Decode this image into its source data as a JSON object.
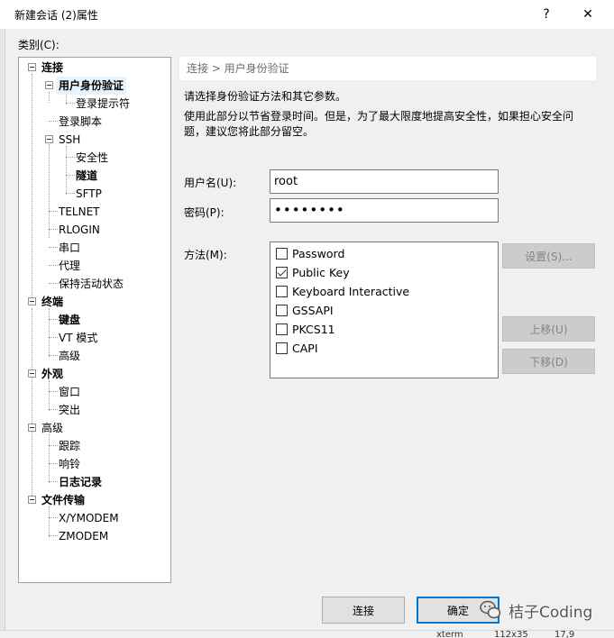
{
  "window": {
    "title": "新建会话 (2)属性",
    "help_glyph": "?",
    "close_glyph": "✕"
  },
  "category": {
    "label": "类别(C):"
  },
  "tree": {
    "items": [
      {
        "label": "连接"
      },
      {
        "label": "用户身份验证"
      },
      {
        "label": "登录提示符"
      },
      {
        "label": "登录脚本"
      },
      {
        "label": "SSH"
      },
      {
        "label": "安全性"
      },
      {
        "label": "隧道"
      },
      {
        "label": "SFTP"
      },
      {
        "label": "TELNET"
      },
      {
        "label": "RLOGIN"
      },
      {
        "label": "串口"
      },
      {
        "label": "代理"
      },
      {
        "label": "保持活动状态"
      },
      {
        "label": "终端"
      },
      {
        "label": "键盘"
      },
      {
        "label": "VT 模式"
      },
      {
        "label": "高级"
      },
      {
        "label": "外观"
      },
      {
        "label": "窗口"
      },
      {
        "label": "突出"
      },
      {
        "label": "高级"
      },
      {
        "label": "跟踪"
      },
      {
        "label": "响铃"
      },
      {
        "label": "日志记录"
      },
      {
        "label": "文件传输"
      },
      {
        "label": "X/YMODEM"
      },
      {
        "label": "ZMODEM"
      }
    ]
  },
  "panel": {
    "breadcrumb": "连接 > 用户身份验证",
    "description_1": "请选择身份验证方法和其它参数。",
    "description_2": "使用此部分以节省登录时间。但是，为了最大限度地提高安全性，如果担心安全问题，建议您将此部分留空。",
    "username_label": "用户名(U):",
    "username_value": "root",
    "password_label": "密码(P):",
    "password_value": "••••••••",
    "method_label": "方法(M):",
    "methods": [
      {
        "label": "Password",
        "checked": false
      },
      {
        "label": "Public Key",
        "checked": true
      },
      {
        "label": "Keyboard Interactive",
        "checked": false
      },
      {
        "label": "GSSAPI",
        "checked": false
      },
      {
        "label": "PKCS11",
        "checked": false
      },
      {
        "label": "CAPI",
        "checked": false
      }
    ],
    "settings_button": "设置(S)...",
    "move_up_button": "上移(U)",
    "move_down_button": "下移(D)"
  },
  "footer": {
    "connect_button": "连接",
    "ok_button": "确定",
    "watermark": "桔子Coding"
  },
  "statusbar": {
    "term": "xterm",
    "size": "112x35",
    "pos": "17,9"
  },
  "colors": {
    "accent": "#0078d7",
    "selected_bg": "#e5f3ff",
    "disabled_text": "#838383"
  }
}
